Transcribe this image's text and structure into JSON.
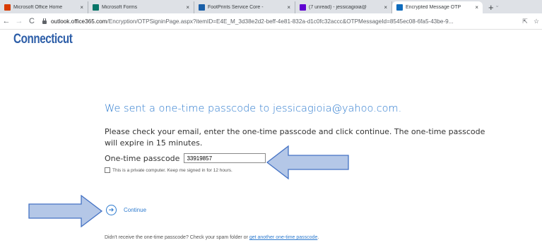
{
  "browser": {
    "tabs": [
      {
        "label": "Microsoft Office Home",
        "close": "×",
        "favicon_color": "#d83b01",
        "favicon": "o-icon"
      },
      {
        "label": "Microsoft Forms",
        "close": "×",
        "favicon_color": "#077568",
        "favicon": "forms-icon"
      },
      {
        "label": "FootPrints Service Core -",
        "close": "×",
        "favicon_color": "#1a5fa8",
        "favicon": "footprints-icon"
      },
      {
        "label": "(7 unread) - jessicagioia@",
        "close": "×",
        "favicon_color": "#5f01d1",
        "favicon": "mail-icon"
      },
      {
        "label": "Encrypted Message OTP",
        "close": "×",
        "favicon_color": "#0f6cbd",
        "favicon": "outlook-icon"
      }
    ],
    "new_tab": "+",
    "url_host": "outlook.office365.com",
    "url_path": "/Encryption/OTPSigninPage.aspx?itemID=E4E_M_3d38e2d2-beff-4e81-832a-d1c0fc32accc&OTPMessageId=8545ec08-6fa5-43be-9..."
  },
  "logo": {
    "text": "Connecticut"
  },
  "page": {
    "heading": "We sent a one-time passcode to jessicagioia@yahoo.com.",
    "instructions": "Please check your email, enter the one-time passcode and click continue. The one-time passcode will expire in 15 minutes.",
    "otp_label": "One-time passcode",
    "otp_value": "33919857",
    "remember_label": "This is a private computer. Keep me signed in for 12 hours.",
    "continue_label": "Continue",
    "footer_text": "Didn't receive the one-time passcode? Check your spam folder or ",
    "footer_link": "get another one-time passcode",
    "footer_end": "."
  },
  "colors": {
    "accent": "#2e7bcf",
    "arrow_fill": "#b4c7e7",
    "arrow_stroke": "#4472c4"
  }
}
